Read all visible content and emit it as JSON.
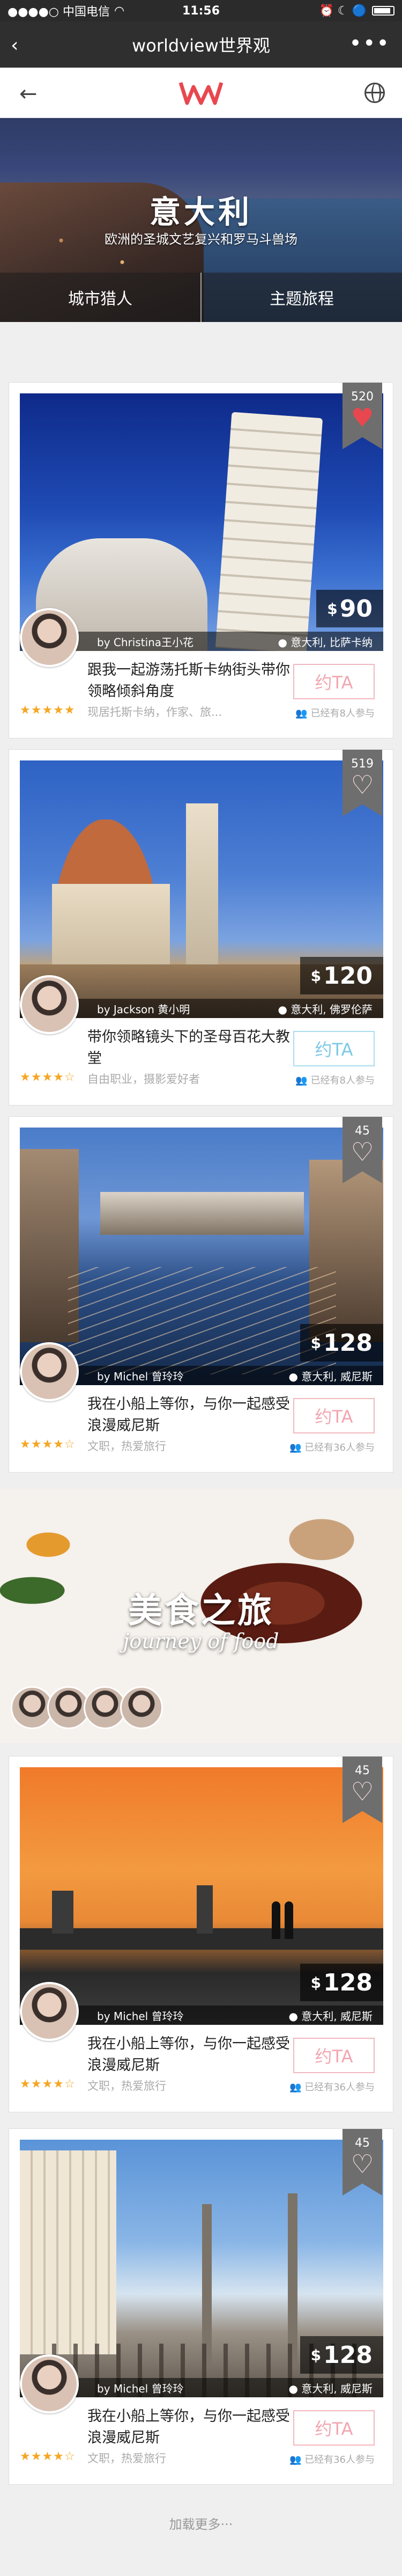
{
  "status_bar": {
    "carrier": "●●●●○ 中国电信",
    "time": "11:56",
    "status_icons": "⏰ ☾ 🔵"
  },
  "wechat": {
    "back": "‹",
    "title": "worldview世界观",
    "more": "•••"
  },
  "app": {
    "logo": "WV",
    "back": "←"
  },
  "hero": {
    "title": "意大利",
    "subtitle": "欧洲的圣城文艺复兴和罗马斗兽场",
    "tabs": [
      "城市猎人",
      "主题旅程"
    ]
  },
  "cards": [
    {
      "likes": "520",
      "liked": true,
      "host": "by Christina王小花",
      "location": "● 意大利, 比萨卡纳",
      "currency": "$",
      "price": "90",
      "title": "跟我一起游荡托斯卡纳街头带你领略倾斜角度",
      "rating": "★★★★★",
      "desc": "现居托斯卡纳，作家、旅...",
      "cta": "约TA",
      "cta_style": "pink",
      "joined": "已经有8人参与",
      "photo": "pisa"
    },
    {
      "likes": "519",
      "liked": false,
      "host": "by Jackson 黄小明",
      "location": "● 意大利, 佛罗伦萨",
      "currency": "$",
      "price": "120",
      "title": "带你领略镜头下的圣母百花大教堂",
      "rating": "★★★★☆",
      "desc": "自由职业，摄影爱好者",
      "cta": "约TA",
      "cta_style": "blue",
      "joined": "已经有8人参与",
      "photo": "florence"
    },
    {
      "likes": "45",
      "liked": false,
      "host": "by Michel 曾玲玲",
      "location": "● 意大利, 威尼斯",
      "currency": "$",
      "price": "128",
      "title": "我在小船上等你，与你一起感受浪漫威尼斯",
      "rating": "★★★★☆",
      "desc": "文职，热爱旅行",
      "cta": "约TA",
      "cta_style": "pink",
      "joined": "已经有36人参与",
      "photo": "venice-night"
    },
    {
      "likes": "45",
      "liked": false,
      "host": "by Michel 曾玲玲",
      "location": "● 意大利, 威尼斯",
      "currency": "$",
      "price": "128",
      "title": "我在小船上等你，与你一起感受浪漫威尼斯",
      "rating": "★★★★☆",
      "desc": "文职，热爱旅行",
      "cta": "约TA",
      "cta_style": "pink",
      "joined": "已经有36人参与",
      "photo": "sunset"
    },
    {
      "likes": "45",
      "liked": false,
      "host": "by Michel 曾玲玲",
      "location": "● 意大利, 威尼斯",
      "currency": "$",
      "price": "128",
      "title": "我在小船上等你，与你一起感受浪漫威尼斯",
      "rating": "★★★★☆",
      "desc": "文职，热爱旅行",
      "cta": "约TA",
      "cta_style": "pink",
      "joined": "已经有36人参与",
      "photo": "piazza"
    }
  ],
  "food_banner": {
    "title": "美食之旅",
    "subtitle": "journey of food"
  },
  "load_more": "加载更多···",
  "colors": {
    "accent_red": "#e8474f",
    "cta_pink": "#f2a6b0",
    "cta_blue": "#7cc8e6",
    "star": "#f5a623"
  }
}
